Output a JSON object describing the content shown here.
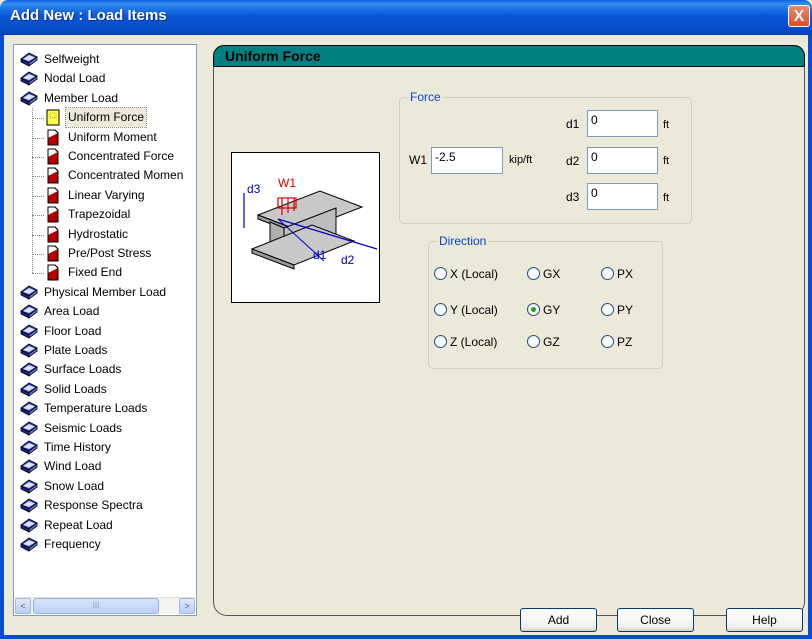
{
  "window": {
    "title": "Add New : Load Items",
    "close_glyph": "X"
  },
  "tree": {
    "items": [
      {
        "label": "Selfweight",
        "icon": "book-icon",
        "level": 0
      },
      {
        "label": "Nodal Load",
        "icon": "book-icon",
        "level": 0
      },
      {
        "label": "Member Load",
        "icon": "book-icon",
        "level": 0
      },
      {
        "label": "Uniform Force",
        "icon": "page-yellow-icon",
        "level": 1,
        "selected": true
      },
      {
        "label": "Uniform Moment",
        "icon": "page-red-icon",
        "level": 1
      },
      {
        "label": "Concentrated Force",
        "icon": "page-red-icon",
        "level": 1
      },
      {
        "label": "Concentrated Momen",
        "icon": "page-red-icon",
        "level": 1
      },
      {
        "label": "Linear Varying",
        "icon": "page-red-icon",
        "level": 1
      },
      {
        "label": "Trapezoidal",
        "icon": "page-red-icon",
        "level": 1
      },
      {
        "label": "Hydrostatic",
        "icon": "page-red-icon",
        "level": 1
      },
      {
        "label": "Pre/Post Stress",
        "icon": "page-red-icon",
        "level": 1
      },
      {
        "label": "Fixed End",
        "icon": "page-red-icon",
        "level": 1
      },
      {
        "label": "Physical Member Load",
        "icon": "book-icon",
        "level": 0
      },
      {
        "label": "Area Load",
        "icon": "book-icon",
        "level": 0
      },
      {
        "label": "Floor Load",
        "icon": "book-icon",
        "level": 0
      },
      {
        "label": "Plate Loads",
        "icon": "book-icon",
        "level": 0
      },
      {
        "label": "Surface Loads",
        "icon": "book-icon",
        "level": 0
      },
      {
        "label": "Solid Loads",
        "icon": "book-icon",
        "level": 0
      },
      {
        "label": "Temperature Loads",
        "icon": "book-icon",
        "level": 0
      },
      {
        "label": "Seismic Loads",
        "icon": "book-icon",
        "level": 0
      },
      {
        "label": "Time History",
        "icon": "book-icon",
        "level": 0
      },
      {
        "label": "Wind Load",
        "icon": "book-icon",
        "level": 0
      },
      {
        "label": "Snow Load",
        "icon": "book-icon",
        "level": 0
      },
      {
        "label": "Response Spectra",
        "icon": "book-icon",
        "level": 0
      },
      {
        "label": "Repeat Load",
        "icon": "book-icon",
        "level": 0
      },
      {
        "label": "Frequency",
        "icon": "book-icon",
        "level": 0
      }
    ],
    "scroll_thumb_grip": "III",
    "scroll_left": "<",
    "scroll_right": ">"
  },
  "panel": {
    "header": "Uniform Force",
    "diagram": {
      "w1": "W1",
      "d1": "d1",
      "d2": "d2",
      "d3": "d3"
    },
    "force": {
      "legend": "Force",
      "w1_label": "W1",
      "w1_value": "-2.5",
      "w1_unit": "kip/ft",
      "d1_label": "d1",
      "d1_value": "0",
      "d1_unit": "ft",
      "d2_label": "d2",
      "d2_value": "0",
      "d2_unit": "ft",
      "d3_label": "d3",
      "d3_value": "0",
      "d3_unit": "ft"
    },
    "direction": {
      "legend": "Direction",
      "options": [
        {
          "label": "X (Local)",
          "checked": false
        },
        {
          "label": "GX",
          "checked": false
        },
        {
          "label": "PX",
          "checked": false
        },
        {
          "label": "Y (Local)",
          "checked": false
        },
        {
          "label": "GY",
          "checked": true
        },
        {
          "label": "PY",
          "checked": false
        },
        {
          "label": "Z (Local)",
          "checked": false
        },
        {
          "label": "GZ",
          "checked": false
        },
        {
          "label": "PZ",
          "checked": false
        }
      ]
    }
  },
  "buttons": {
    "add": "Add",
    "close": "Close",
    "help": "Help"
  },
  "colors": {
    "title_bar": "#0a58d8",
    "header_bar": "#008080",
    "legend_text": "#0046d5",
    "dialog_bg": "#ece9d8"
  }
}
